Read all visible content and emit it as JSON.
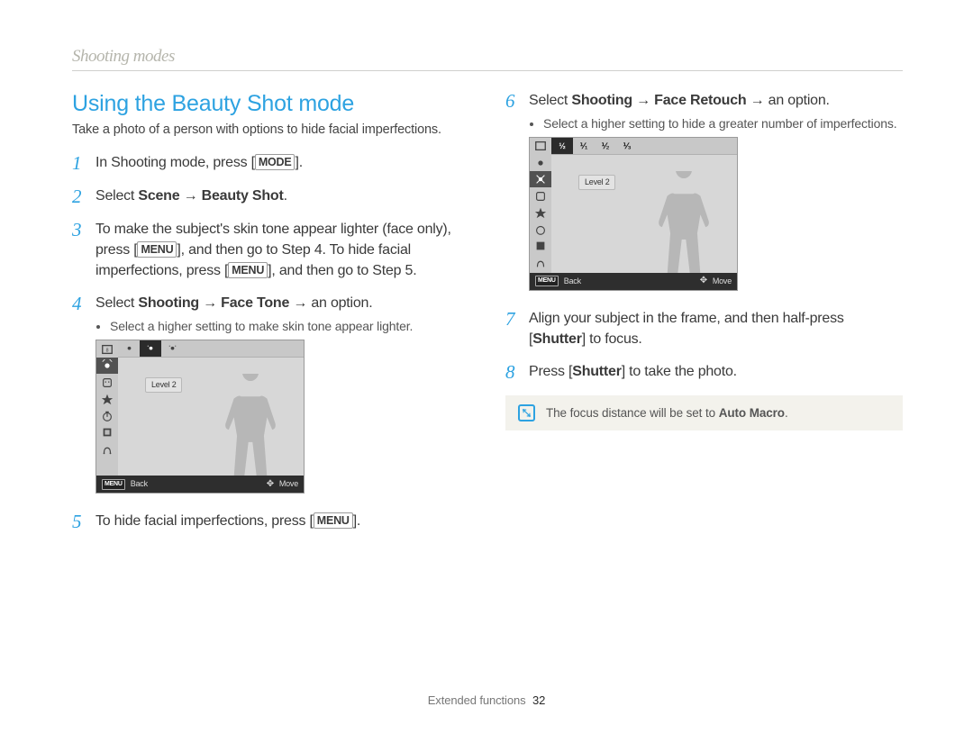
{
  "section_label": "Shooting modes",
  "title": "Using the Beauty Shot mode",
  "intro": "Take a photo of a person with options to hide facial imperfections.",
  "key_mode": "MODE",
  "key_menu": "MENU",
  "steps_left": {
    "s1_a": "In Shooting mode, press [",
    "s1_b": "].",
    "s2_a": "Select ",
    "s2_b": "Scene",
    "s2_c": " → ",
    "s2_d": "Beauty Shot",
    "s2_e": ".",
    "s3_a": "To make the subject's skin tone appear lighter (face only), press [",
    "s3_b": "], and then go to Step 4. To hide facial imperfections, press [",
    "s3_c": "], and then go to Step 5.",
    "s4_a": "Select ",
    "s4_b": "Shooting",
    "s4_c": " → ",
    "s4_d": "Face Tone",
    "s4_e": " → an option.",
    "s4_bullet": "Select a higher setting to make skin tone appear lighter.",
    "s5_a": "To hide facial imperfections, press [",
    "s5_b": "]."
  },
  "steps_right": {
    "s6_a": "Select ",
    "s6_b": "Shooting",
    "s6_c": " → ",
    "s6_d": "Face Retouch",
    "s6_e": " → an option.",
    "s6_bullet": "Select a higher setting to hide a greater number of imperfections.",
    "s7_a": "Align your subject in the frame, and then half-press [",
    "s7_b": "Shutter",
    "s7_c": "] to focus.",
    "s8_a": "Press [",
    "s8_b": "Shutter",
    "s8_c": "] to take the photo."
  },
  "note_a": "The focus distance will be set to ",
  "note_b": "Auto Macro",
  "note_c": ".",
  "lcd": {
    "level_label": "Level 2",
    "back_label": "Back",
    "move_label": "Move",
    "menu_key": "MENU",
    "fractions": [
      "½",
      "⅟₁",
      "⅟₂",
      "⅟₃"
    ]
  },
  "footer_label": "Extended functions",
  "footer_page": "32",
  "step_numbers": [
    "1",
    "2",
    "3",
    "4",
    "5",
    "6",
    "7",
    "8"
  ]
}
